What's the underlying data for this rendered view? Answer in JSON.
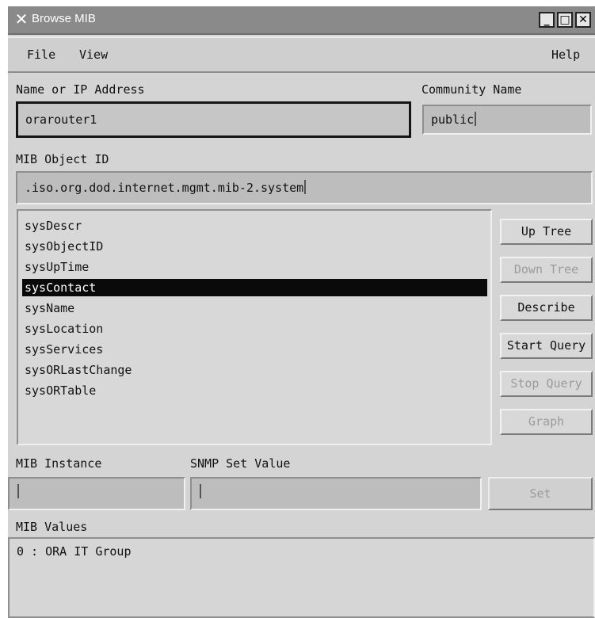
{
  "window": {
    "title": "Browse MIB",
    "app_icon": "x-window-icon",
    "controls": {
      "minimize": "_",
      "maximize": "□",
      "close": "✕"
    }
  },
  "menu": {
    "file": "File",
    "view": "View",
    "help": "Help"
  },
  "host": {
    "label": "Name or IP Address",
    "value": "orarouter1"
  },
  "community": {
    "label": "Community Name",
    "value": "public"
  },
  "oid": {
    "label": "MIB Object ID",
    "value": ".iso.org.dod.internet.mgmt.mib-2.system"
  },
  "mib_list": {
    "items": [
      "sysDescr",
      "sysObjectID",
      "sysUpTime",
      "sysContact",
      "sysName",
      "sysLocation",
      "sysServices",
      "sysORLastChange",
      "sysORTable"
    ],
    "selected": "sysContact"
  },
  "buttons": {
    "up_tree": "Up Tree",
    "down_tree": "Down Tree",
    "describe": "Describe",
    "start_query": "Start Query",
    "stop_query": "Stop Query",
    "graph": "Graph",
    "set": "Set"
  },
  "instance": {
    "label": "MIB Instance",
    "value": ""
  },
  "set_value": {
    "label": "SNMP Set Value",
    "value": ""
  },
  "values": {
    "label": "MIB Values",
    "content": "0 : ORA IT Group"
  }
}
